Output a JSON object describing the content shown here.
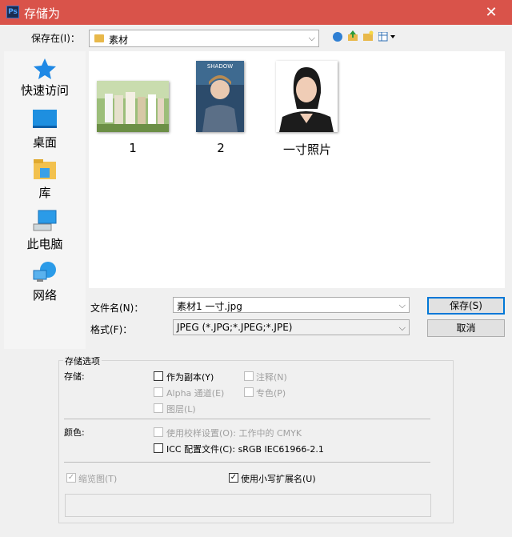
{
  "window": {
    "title": "存储为",
    "app_icon": "Ps",
    "close": "✕"
  },
  "save_in": {
    "label": "保存在(I)：",
    "folder": "素材"
  },
  "places": [
    {
      "label": "快速访问",
      "icon": "star-icon"
    },
    {
      "label": "桌面",
      "icon": "desktop-icon"
    },
    {
      "label": "库",
      "icon": "library-icon"
    },
    {
      "label": "此电脑",
      "icon": "computer-icon"
    },
    {
      "label": "网络",
      "icon": "network-icon"
    }
  ],
  "files": [
    {
      "name": "1"
    },
    {
      "name": "2"
    },
    {
      "name": "一寸照片"
    }
  ],
  "filename": {
    "label": "文件名(N)：",
    "value": "素材1 一寸.jpg"
  },
  "format": {
    "label": "格式(F)：",
    "value": "JPEG (*.JPG;*.JPEG;*.JPE)"
  },
  "buttons": {
    "save": "保存(S)",
    "cancel": "取消"
  },
  "options": {
    "group_title": "存储选项",
    "store_label": "存储:",
    "as_copy": "作为副本(Y)",
    "notes": "注释(N)",
    "alpha": "Alpha 通道(E)",
    "spot": "专色(P)",
    "layers": "图层(L)",
    "color_label": "颜色:",
    "proof": "使用校样设置(O): 工作中的 CMYK",
    "icc": "ICC 配置文件(C): sRGB IEC61966-2.1",
    "thumbnail": "缩览图(T)",
    "lowercase_ext": "使用小写扩展名(U)"
  }
}
